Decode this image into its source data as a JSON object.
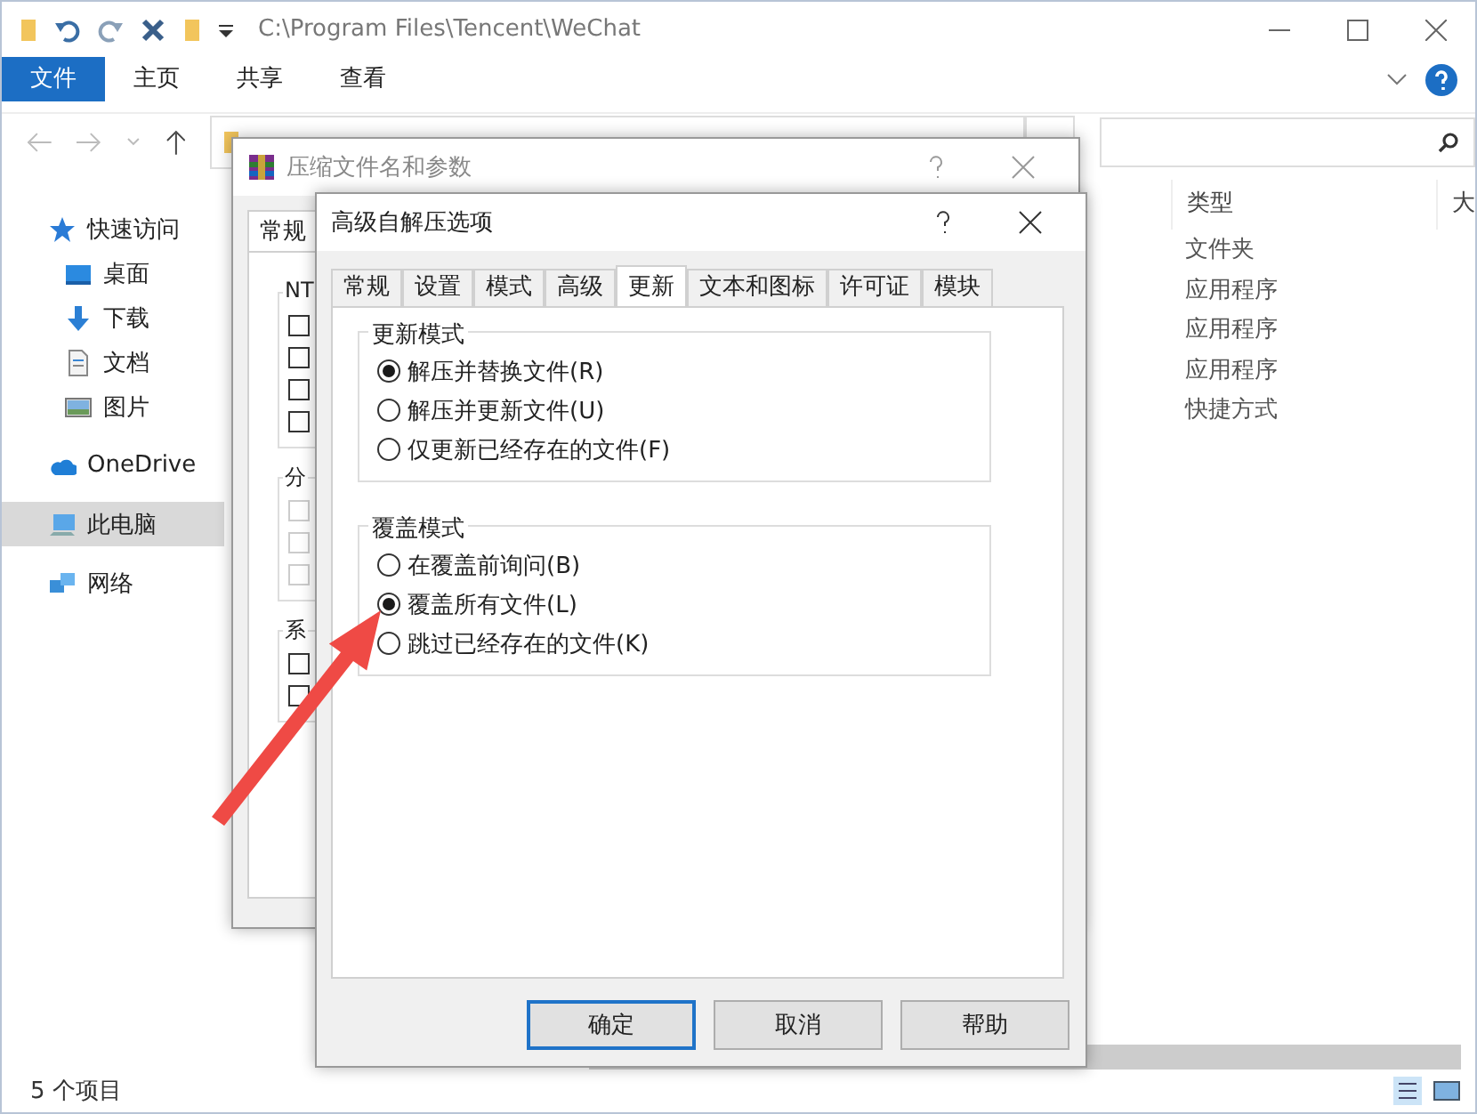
{
  "explorer": {
    "title": "C:\\Program Files\\Tencent\\WeChat",
    "ribbon_tabs": [
      {
        "label": "文件",
        "selected": true
      },
      {
        "label": "主页",
        "selected": false
      },
      {
        "label": "共享",
        "selected": false
      },
      {
        "label": "查看",
        "selected": false
      }
    ],
    "sidebar": [
      {
        "label": "快速访问",
        "kind": "star",
        "selected": false,
        "children": [
          {
            "label": "桌面",
            "kind": "desktop",
            "selected": false
          },
          {
            "label": "下载",
            "kind": "download",
            "selected": false
          },
          {
            "label": "文档",
            "kind": "document",
            "selected": false
          },
          {
            "label": "图片",
            "kind": "picture",
            "selected": false
          }
        ]
      },
      {
        "label": "OneDrive",
        "kind": "cloud",
        "selected": false
      },
      {
        "label": "此电脑",
        "kind": "computer",
        "selected": true
      },
      {
        "label": "网络",
        "kind": "network",
        "selected": false
      }
    ],
    "columns": [
      "类型",
      "大"
    ],
    "rows": [
      "文件夹",
      "应用程序",
      "应用程序",
      "应用程序",
      "快捷方式"
    ],
    "status": "5 个项目"
  },
  "back_dialog": {
    "title": "压缩文件名和参数",
    "tabs": [
      {
        "label": "常规",
        "selected": true
      }
    ],
    "groups": [
      {
        "label": "NT",
        "checkboxes": [
          {
            "checked": false,
            "disabled": false
          },
          {
            "checked": false,
            "disabled": false
          },
          {
            "checked": false,
            "disabled": false
          },
          {
            "checked": false,
            "disabled": false
          }
        ]
      },
      {
        "label": "分",
        "checkboxes": [
          {
            "checked": false,
            "disabled": true
          },
          {
            "checked": false,
            "disabled": true
          },
          {
            "checked": false,
            "disabled": true
          }
        ]
      },
      {
        "label": "系",
        "checkboxes": [
          {
            "checked": false,
            "disabled": false
          },
          {
            "checked": false,
            "disabled": false
          }
        ]
      }
    ]
  },
  "dialog": {
    "title": "高级自解压选项",
    "tabs": [
      {
        "label": "常规",
        "selected": false
      },
      {
        "label": "设置",
        "selected": false
      },
      {
        "label": "模式",
        "selected": false
      },
      {
        "label": "高级",
        "selected": false
      },
      {
        "label": "更新",
        "selected": true
      },
      {
        "label": "文本和图标",
        "selected": false
      },
      {
        "label": "许可证",
        "selected": false
      },
      {
        "label": "模块",
        "selected": false
      }
    ],
    "groups": [
      {
        "title": "更新模式",
        "options": [
          {
            "label": "解压并替换文件(R)",
            "selected": true
          },
          {
            "label": "解压并更新文件(U)",
            "selected": false
          },
          {
            "label": "仅更新已经存在的文件(F)",
            "selected": false
          }
        ]
      },
      {
        "title": "覆盖模式",
        "options": [
          {
            "label": "在覆盖前询问(B)",
            "selected": false
          },
          {
            "label": "覆盖所有文件(L)",
            "selected": true
          },
          {
            "label": "跳过已经存在的文件(K)",
            "selected": false
          }
        ]
      }
    ],
    "buttons": [
      {
        "label": "确定",
        "default": true
      },
      {
        "label": "取消",
        "default": false
      },
      {
        "label": "帮助",
        "default": false
      }
    ]
  }
}
